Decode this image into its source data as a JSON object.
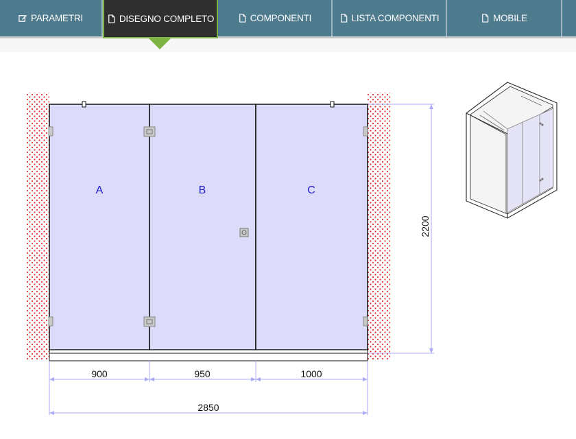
{
  "tabs": [
    {
      "label": "PARAMETRI",
      "icon": "edit-icon"
    },
    {
      "label": "DISEGNO COMPLETO",
      "icon": "file-icon"
    },
    {
      "label": "COMPONENTI",
      "icon": "file-icon"
    },
    {
      "label": "LISTA COMPONENTI",
      "icon": "file-icon"
    },
    {
      "label": "MOBILE",
      "icon": "file-icon"
    }
  ],
  "active_tab": "DISEGNO COMPLETO",
  "drawing": {
    "panels": [
      "A",
      "B",
      "C"
    ],
    "widths": [
      "900",
      "950",
      "1000"
    ],
    "total_width": "2850",
    "height": "2200"
  },
  "colors": {
    "nav_bg": "#4d7a8c",
    "active_tab_bg": "#2f2f2f",
    "accent_green": "#7cb342",
    "glass_fill": "#dcdcfa",
    "dimension_line": "#aaaaf5",
    "panel_label": "#1c1cc8"
  }
}
